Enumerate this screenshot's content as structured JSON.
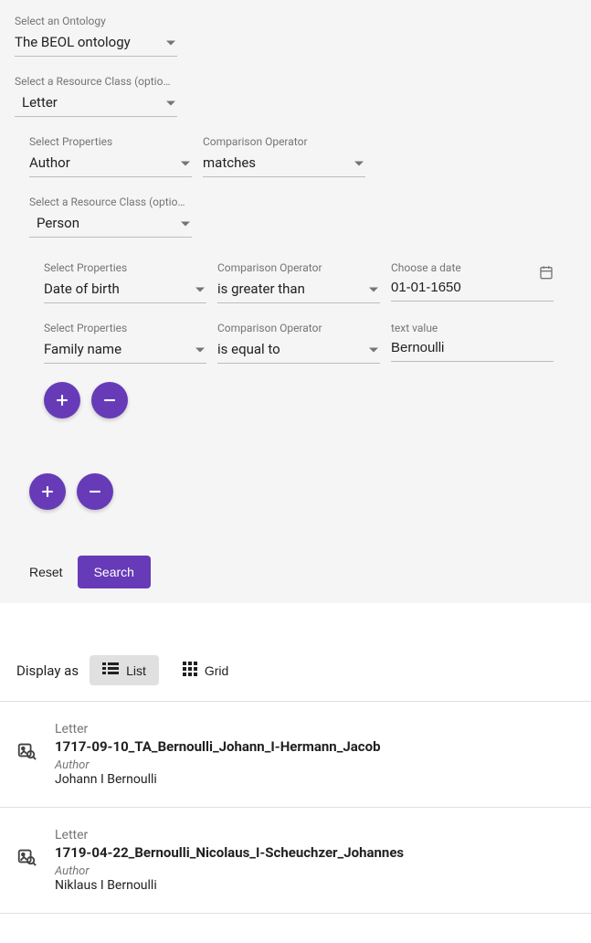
{
  "ontology": {
    "label": "Select an Ontology",
    "value": "The BEOL ontology"
  },
  "resourceClass": {
    "label": "Select a Resource Class (optio…",
    "value": "Letter"
  },
  "properties1": {
    "propLabel": "Select Properties",
    "propValue": "Author",
    "opLabel": "Comparison Operator",
    "opValue": "matches"
  },
  "resourceClass2": {
    "label": "Select a Resource Class (optio…",
    "value": "Person"
  },
  "propRow1": {
    "propLabel": "Select Properties",
    "propValue": "Date of birth",
    "opLabel": "Comparison Operator",
    "opValue": "is greater than",
    "valLabel": "Choose a date",
    "valValue": "01-01-1650"
  },
  "propRow2": {
    "propLabel": "Select Properties",
    "propValue": "Family name",
    "opLabel": "Comparison Operator",
    "opValue": "is equal to",
    "valLabel": "text value",
    "valValue": "Bernoulli"
  },
  "actions": {
    "reset": "Reset",
    "search": "Search"
  },
  "display": {
    "label": "Display as",
    "list": "List",
    "grid": "Grid"
  },
  "results": [
    {
      "type": "Letter",
      "title": "1717-09-10_TA_Bernoulli_Johann_I-Hermann_Jacob",
      "metaLabel": "Author",
      "metaValue": "Johann I Bernoulli"
    },
    {
      "type": "Letter",
      "title": "1719-04-22_Bernoulli_Nicolaus_I-Scheuchzer_Johannes",
      "metaLabel": "Author",
      "metaValue": "Niklaus I Bernoulli"
    }
  ]
}
